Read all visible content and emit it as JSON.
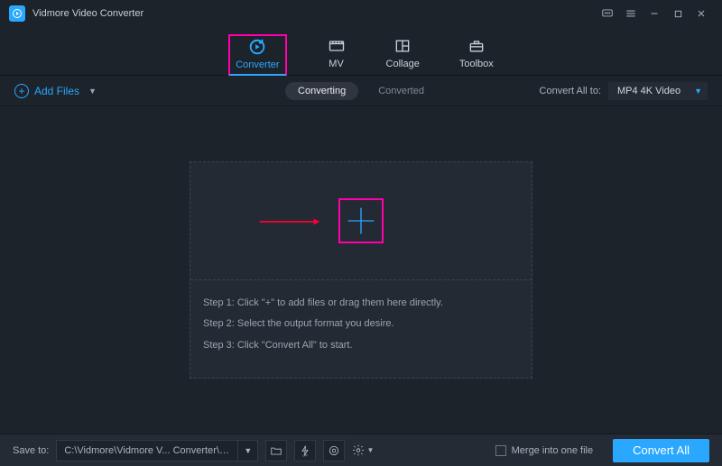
{
  "app": {
    "title": "Vidmore Video Converter"
  },
  "tabs": {
    "converter": "Converter",
    "mv": "MV",
    "collage": "Collage",
    "toolbox": "Toolbox"
  },
  "toolbar": {
    "add_files": "Add Files",
    "converting": "Converting",
    "converted": "Converted",
    "convert_all_to_label": "Convert All to:",
    "convert_all_to_value": "MP4 4K Video"
  },
  "steps": {
    "s1": "Step 1: Click \"+\" to add files or drag them here directly.",
    "s2": "Step 2: Select the output format you desire.",
    "s3": "Step 3: Click \"Convert All\" to start."
  },
  "bottom": {
    "save_to_label": "Save to:",
    "path": "C:\\Vidmore\\Vidmore V... Converter\\Converted",
    "merge_label": "Merge into one file",
    "convert_all_btn": "Convert All"
  }
}
